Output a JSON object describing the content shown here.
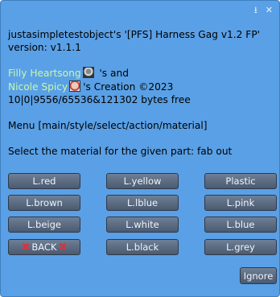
{
  "header": {
    "minimize_icon": "download-arrow-icon",
    "close_icon": "x-icon"
  },
  "message": {
    "line1": "justasimpletestobject's '[PFS] Harness Gag v1.2 FP'",
    "line2": "version: v1.1.1",
    "creator1": "Filly Heartsong",
    "creator1_suffix": "'s and",
    "creator2": "Nicole Spicy",
    "creator2_suffix": "'s Creation ©2023",
    "memory": "10|0|9556/65536&121302 bytes free",
    "menu": "Menu [main/style/select/action/material]",
    "prompt": "Select the material for the given part: fab out"
  },
  "buttons": {
    "b1": "L.red",
    "b2": "L.yellow",
    "b3": "Plastic",
    "b4": "L.brown",
    "b5": "L.lblue",
    "b6": "L.pink",
    "b7": "L.beige",
    "b8": "L.white",
    "b9": "L.blue",
    "back": "BACK",
    "b11": "L.black",
    "b12": "L.grey",
    "ignore": "Ignore"
  },
  "colors": {
    "background": "#5aa0e6",
    "link": "#c8f7a8",
    "button": "#5b6b80"
  }
}
